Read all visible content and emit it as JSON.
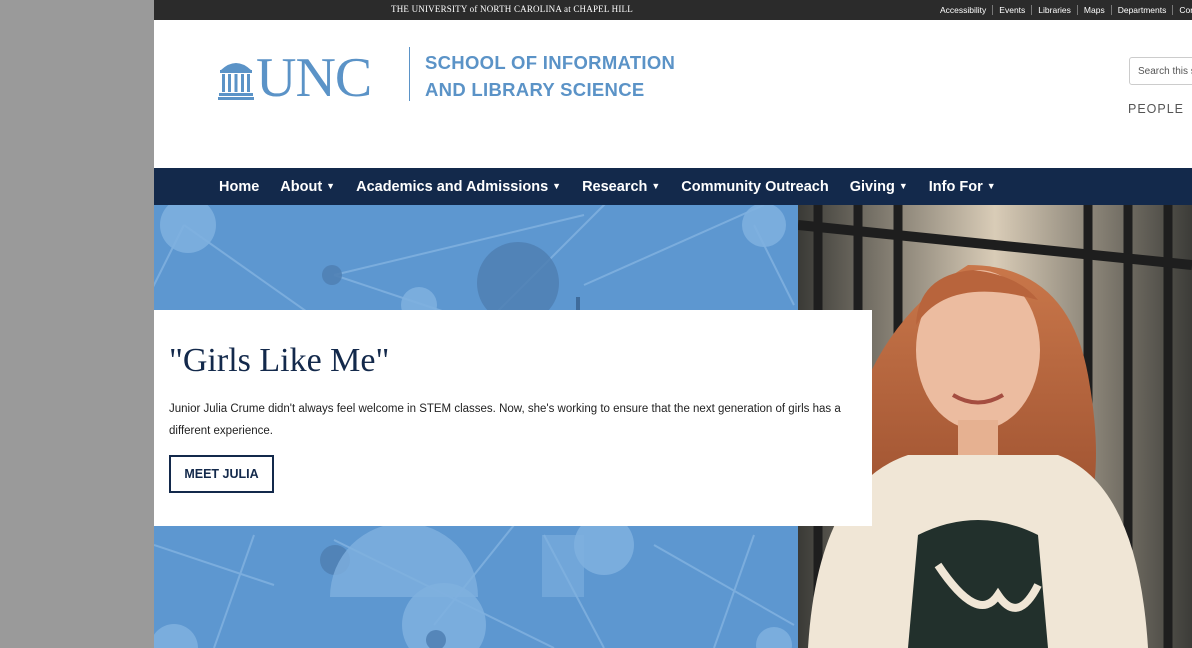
{
  "topbar": {
    "university": "THE UNIVERSITY of NORTH CAROLINA at CHAPEL HILL",
    "links": [
      "Accessibility",
      "Events",
      "Libraries",
      "Maps",
      "Departments",
      "Connect"
    ]
  },
  "header": {
    "logo_text": "UNC",
    "school_line1": "SCHOOL OF INFORMATION",
    "school_line2": "AND LIBRARY SCIENCE",
    "search_placeholder": "Search this site",
    "people_link": "PEOPLE"
  },
  "nav": {
    "items": [
      {
        "label": "Home",
        "dropdown": false
      },
      {
        "label": "About",
        "dropdown": true
      },
      {
        "label": "Academics and Admissions",
        "dropdown": true
      },
      {
        "label": "Research",
        "dropdown": true
      },
      {
        "label": "Community Outreach",
        "dropdown": false
      },
      {
        "label": "Giving",
        "dropdown": true
      },
      {
        "label": "Info For",
        "dropdown": true
      }
    ]
  },
  "hero": {
    "title": "\"Girls Like Me\"",
    "text": "Junior Julia Crume didn't always feel welcome in STEM classes. Now, she's working to ensure that the next generation of girls has a different experience.",
    "button_label": "MEET JULIA"
  },
  "colors": {
    "brand_blue": "#5b93c7",
    "navy": "#13294b",
    "hero_blue": "#5d97d0"
  }
}
